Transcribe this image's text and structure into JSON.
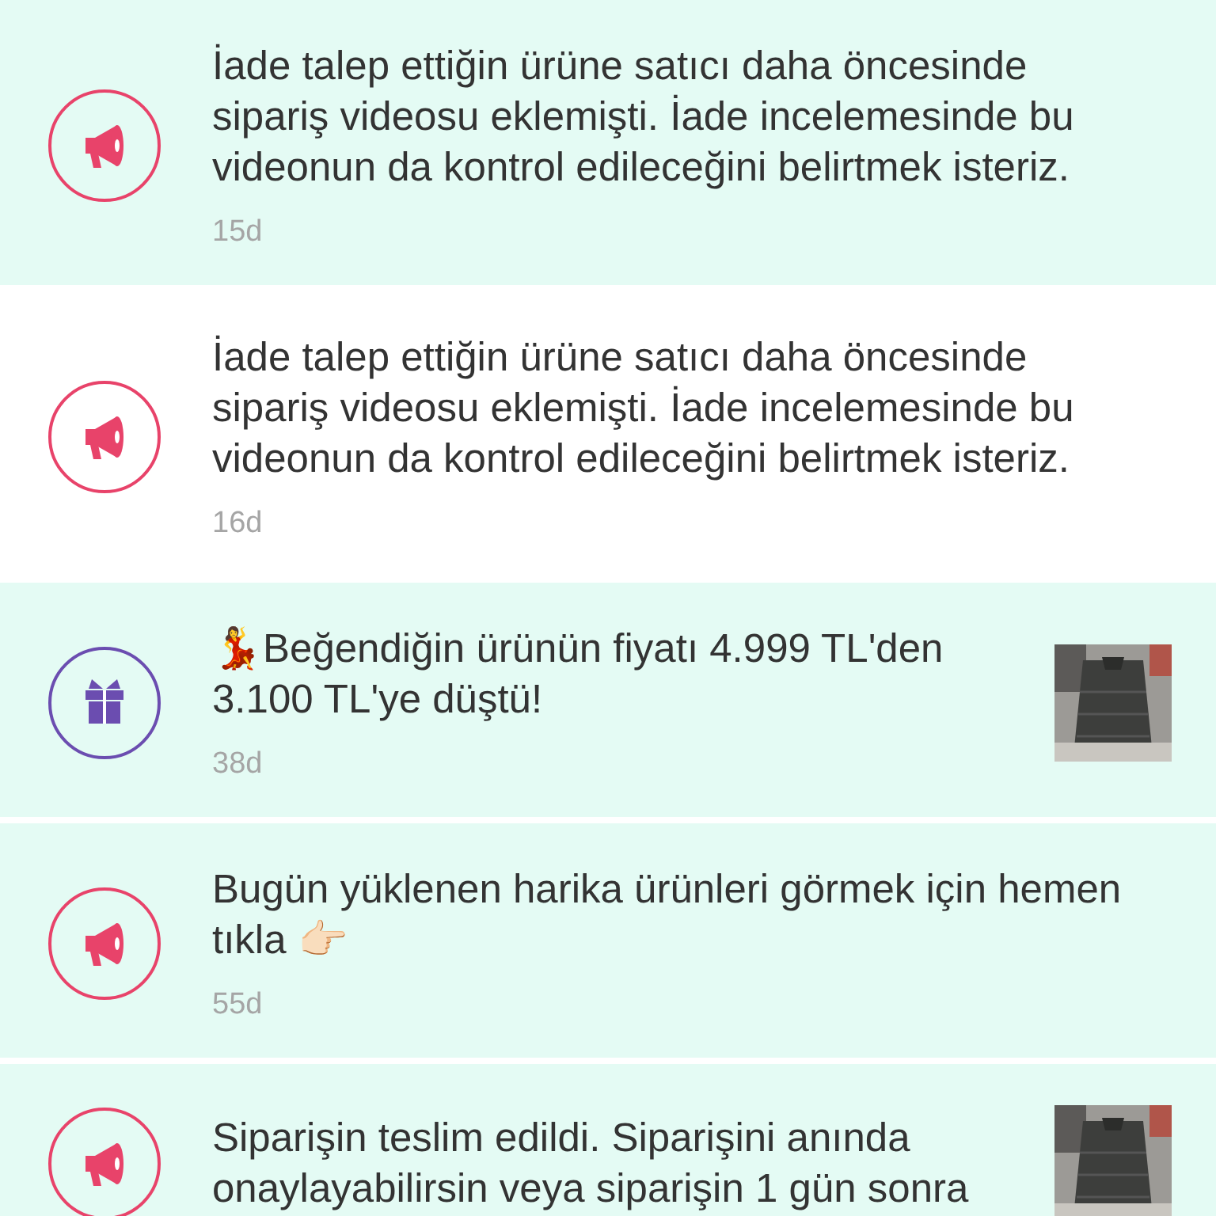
{
  "notifications": [
    {
      "kind": "megaphone",
      "unread": true,
      "text": "İade talep ettiğin ürüne satıcı daha öncesinde sipariş videosu eklemişti. İade incelemesinde bu videonun da kontrol edileceğini belirtmek isteriz.",
      "time": "15d"
    },
    {
      "kind": "megaphone",
      "unread": false,
      "text": "İade talep ettiğin ürüne satıcı daha öncesinde sipariş videosu eklemişti. İade incelemesinde bu videonun da kontrol edileceğini belirtmek isteriz.",
      "time": "16d"
    },
    {
      "kind": "gift",
      "unread": true,
      "text": "💃Beğendiğin ürünün fiyatı 4.999 TL'den 3.100 TL'ye düştü!",
      "time": "38d"
    },
    {
      "kind": "megaphone",
      "unread": true,
      "text": "Bugün yüklenen harika ürünleri görmek için hemen tıkla 👉🏻",
      "time": "55d"
    },
    {
      "kind": "megaphone",
      "unread": true,
      "text": "Siparişin teslim edildi. Siparişini anında onaylayabilirsin veya siparişin 1 gün sonra"
    }
  ]
}
